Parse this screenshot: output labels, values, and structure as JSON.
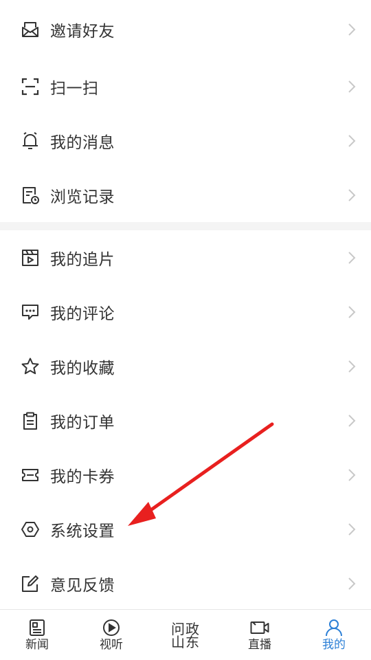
{
  "menu_group_1": [
    {
      "label": "邀请好友",
      "icon": "envelope-icon"
    },
    {
      "label": "扫一扫",
      "icon": "scan-icon"
    },
    {
      "label": "我的消息",
      "icon": "bell-icon"
    },
    {
      "label": "浏览记录",
      "icon": "history-icon"
    }
  ],
  "menu_group_2": [
    {
      "label": "我的追片",
      "icon": "video-follow-icon"
    },
    {
      "label": "我的评论",
      "icon": "comment-icon"
    },
    {
      "label": "我的收藏",
      "icon": "star-icon"
    },
    {
      "label": "我的订单",
      "icon": "clipboard-icon"
    },
    {
      "label": "我的卡券",
      "icon": "ticket-icon"
    },
    {
      "label": "系统设置",
      "icon": "settings-hexagon-icon"
    },
    {
      "label": "意见反馈",
      "icon": "edit-icon"
    }
  ],
  "tabbar": {
    "tabs": [
      {
        "label": "新闻",
        "icon": "news-icon"
      },
      {
        "label": "视听",
        "icon": "play-icon"
      },
      {
        "logo_line1": "问政",
        "logo_line2": "山东",
        "icon": "wenzheng-logo-icon"
      },
      {
        "label": "直播",
        "icon": "camera-icon"
      },
      {
        "label": "我的",
        "icon": "user-icon",
        "active": true
      }
    ]
  },
  "colors": {
    "accent": "#2b7fd6",
    "arrow": "#e8201f",
    "divider": "#f4f4f4"
  }
}
